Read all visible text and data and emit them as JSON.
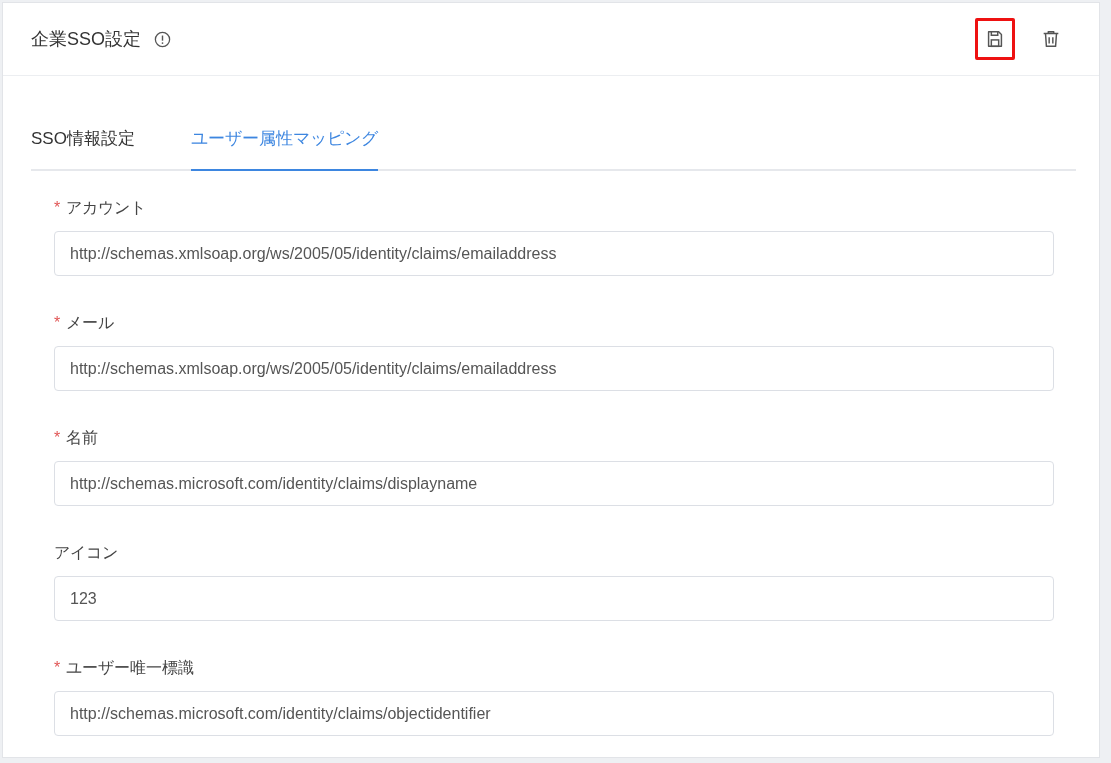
{
  "header": {
    "title": "企業SSO設定",
    "actions": [
      {
        "kind": "save",
        "highlighted": true
      },
      {
        "kind": "delete",
        "highlighted": false
      }
    ]
  },
  "tabs": [
    {
      "label": "SSO情報設定",
      "selected": false
    },
    {
      "label": "ユーザー属性マッピング",
      "selected": true
    }
  ],
  "required_mark": "*",
  "fields": [
    {
      "label": "アカウント",
      "required": true,
      "value": "http://schemas.xmlsoap.org/ws/2005/05/identity/claims/emailaddress"
    },
    {
      "label": "メール",
      "required": true,
      "value": "http://schemas.xmlsoap.org/ws/2005/05/identity/claims/emailaddress"
    },
    {
      "label": "名前",
      "required": true,
      "value": "http://schemas.microsoft.com/identity/claims/displayname"
    },
    {
      "label": "アイコン",
      "required": false,
      "value": "123"
    },
    {
      "label": "ユーザー唯一標識",
      "required": true,
      "value": "http://schemas.microsoft.com/identity/claims/objectidentifier"
    }
  ]
}
